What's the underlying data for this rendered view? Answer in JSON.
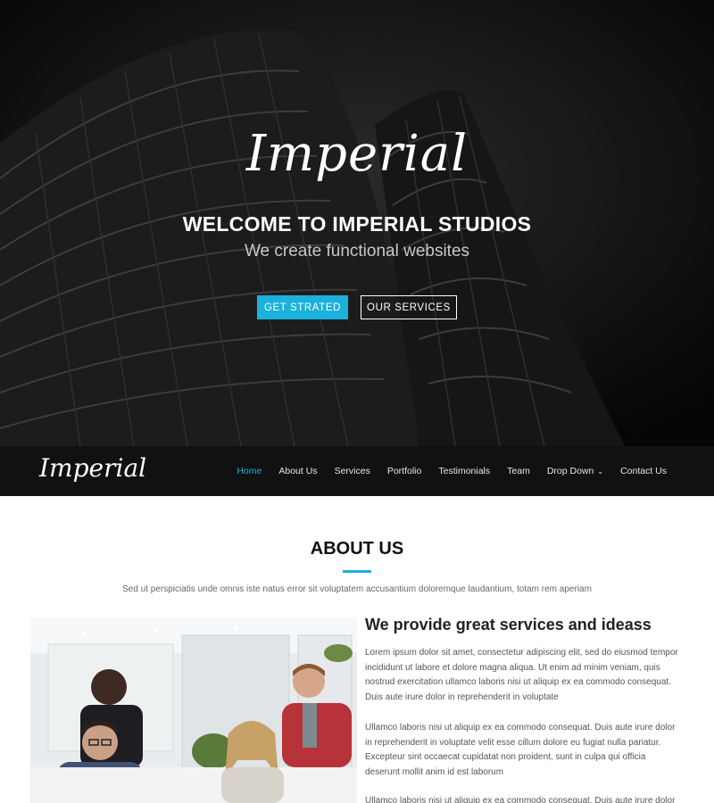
{
  "hero": {
    "logo": "Imperial",
    "title": "WELCOME TO IMPERIAL STUDIOS",
    "subtitle": "We create functional websites",
    "primary_button": "GET STRATED",
    "secondary_button": "OUR SERVICES"
  },
  "navbar": {
    "logo": "Imperial",
    "items": [
      {
        "label": "Home",
        "active": true
      },
      {
        "label": "About Us"
      },
      {
        "label": "Services"
      },
      {
        "label": "Portfolio"
      },
      {
        "label": "Testimonials"
      },
      {
        "label": "Team"
      },
      {
        "label": "Drop Down",
        "has_dropdown": true
      },
      {
        "label": "Contact Us"
      }
    ],
    "caret": "⌄"
  },
  "about": {
    "title": "ABOUT US",
    "description": "Sed ut perspiciatis unde omnis iste natus error sit voluptatem accusantium doloremque laudantium, totam rem aperiam",
    "heading": "We provide great services and ideass",
    "paragraphs": [
      "Lorem ipsum dolor sit amet, consectetur adipiscing elit, sed do eiusmod tempor incididunt ut labore et dolore magna aliqua. Ut enim ad minim veniam, quis nostrud exercitation ullamco laboris nisi ut aliquip ex ea commodo consequat. Duis aute irure dolor in reprehenderit in voluptate",
      "Ullamco laboris nisi ut aliquip ex ea commodo consequat. Duis aute irure dolor in reprehenderit in voluptate velit esse cillum dolore eu fugiat nulla pariatur. Excepteur sint occaecat cupidatat non proident, sunt in culpa qui officia deserunt mollit anim id est laborum",
      "Ullamco laboris nisi ut aliquip ex ea commodo consequat. Duis aute irure dolor in reprehenderit"
    ]
  },
  "colors": {
    "accent": "#1bb1dc",
    "navbar_bg": "#111111",
    "hero_bg": "#0b0b0b"
  },
  "icons": {
    "caret": "chevron-down-icon"
  }
}
